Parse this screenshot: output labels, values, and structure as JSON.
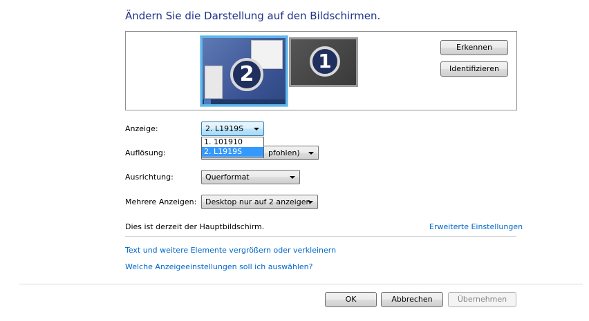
{
  "heading": "Ändern Sie die Darstellung auf den Bildschirmen.",
  "preview": {
    "monitor_secondary_number": "2",
    "monitor_primary_number": "1"
  },
  "buttons": {
    "detect": "Erkennen",
    "identify": "Identifizieren",
    "ok": "OK",
    "cancel": "Abbrechen",
    "apply": "Übernehmen"
  },
  "form": {
    "display_label": "Anzeige:",
    "display_value": "2. L1919S",
    "display_options": [
      "1. 101910",
      "2. L1919S"
    ],
    "resolution_label": "Auflösung:",
    "resolution_value_visible": "pfohlen)",
    "orientation_label": "Ausrichtung:",
    "orientation_value": "Querformat",
    "multiple_label": "Mehrere Anzeigen:",
    "multiple_value": "Desktop nur auf 2 anzeigen"
  },
  "status_text": "Dies ist derzeit der Hauptbildschirm.",
  "links": {
    "advanced": "Erweiterte Einstellungen",
    "text_size": "Text und weitere Elemente vergrößern oder verkleinern",
    "which_settings": "Welche Anzeigeeinstellungen soll ich auswählen?"
  },
  "colors": {
    "heading": "#1e3287",
    "link": "#0066cc",
    "selection": "#3399ff"
  }
}
